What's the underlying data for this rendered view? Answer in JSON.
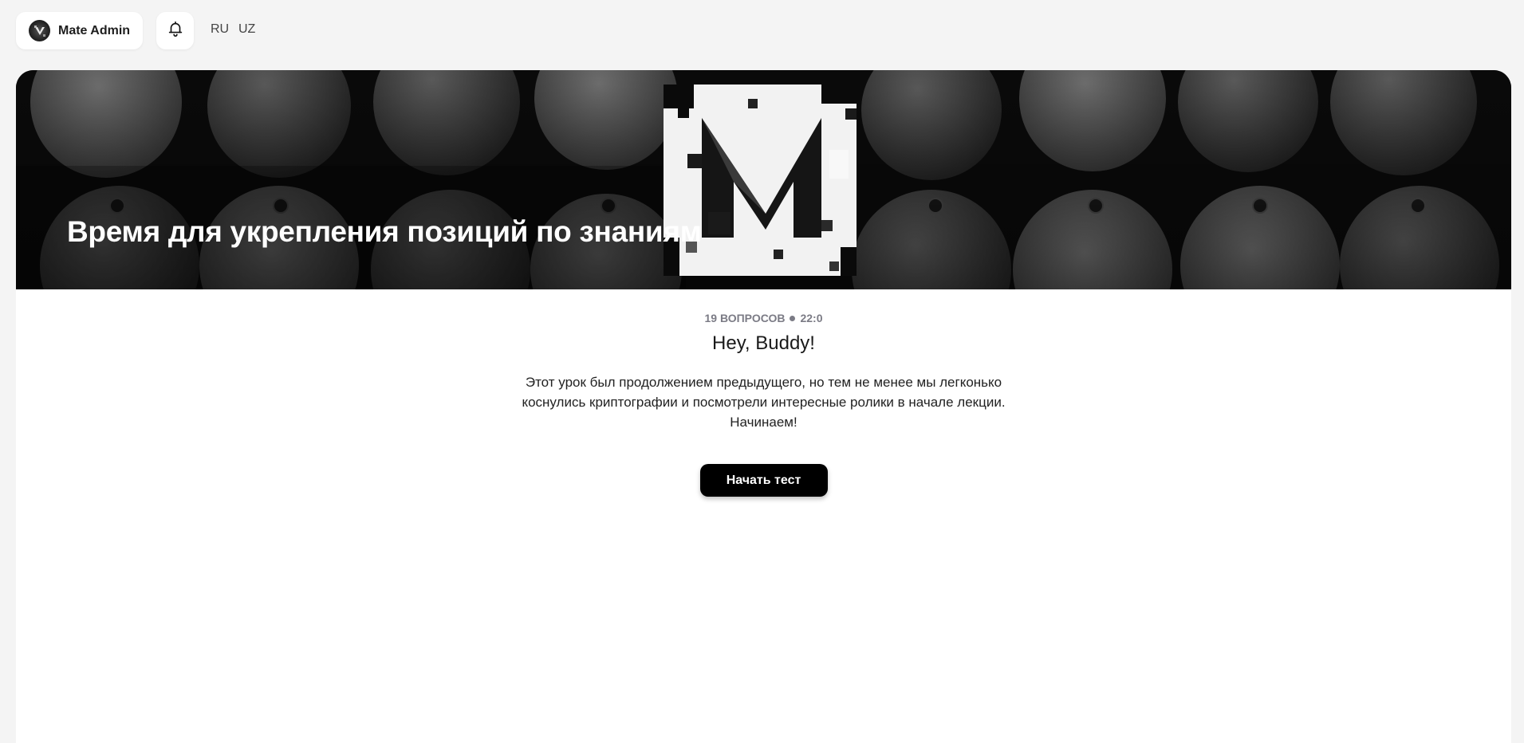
{
  "header": {
    "user_name": "Mate Admin",
    "languages": [
      "RU",
      "UZ"
    ]
  },
  "banner": {
    "title": "Время для укрепления позиций по знаниям"
  },
  "quiz": {
    "questions_count": "19 ВОПРОСОВ",
    "duration": "22:0",
    "greeting": "Hey, Buddy!",
    "description": "Этот урок был продолжением предыдущего, но тем не менее мы легконько коснулись криптографии и посмотрели интересные ролики в начале лекции. Начинаем!",
    "start_label": "Начать тест"
  },
  "icons": {
    "bell": "bell-icon",
    "avatar": "logo-avatar-icon"
  },
  "colors": {
    "page_bg": "#f4f4f4",
    "button_bg": "#000000",
    "meta_text": "#7b7b85"
  }
}
